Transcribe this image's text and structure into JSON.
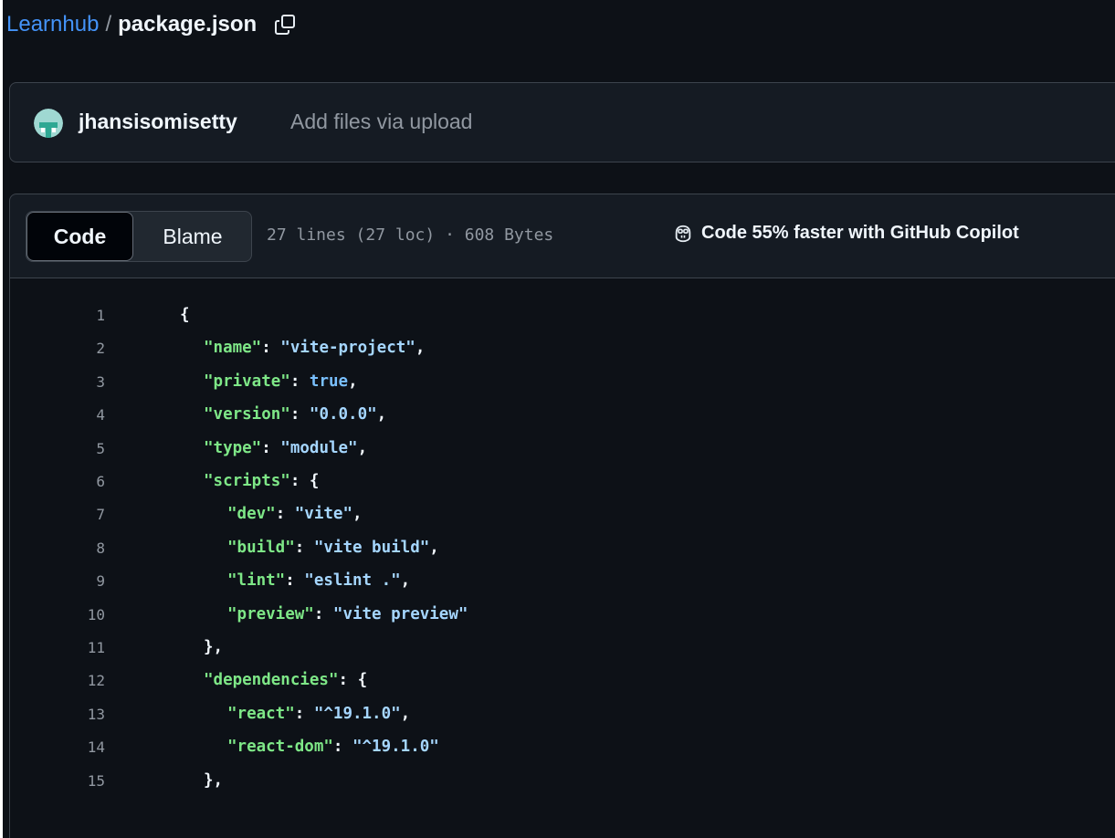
{
  "breadcrumb": {
    "repo": "Learnhub",
    "separator": "/",
    "file": "package.json"
  },
  "commit": {
    "author": "jhansisomisetty",
    "message": "Add files via upload"
  },
  "file_header": {
    "tabs": [
      {
        "label": "Code",
        "active": true
      },
      {
        "label": "Blame",
        "active": false
      }
    ],
    "info": "27 lines (27 loc) · 608 Bytes",
    "copilot_label": "Code 55% faster with GitHub Copilot"
  },
  "code_lines": [
    {
      "n": "1",
      "indent": 0,
      "tokens": [
        {
          "t": "p",
          "v": "{"
        }
      ]
    },
    {
      "n": "2",
      "indent": 1,
      "tokens": [
        {
          "t": "k",
          "v": "\"name\""
        },
        {
          "t": "p",
          "v": ": "
        },
        {
          "t": "s",
          "v": "\"vite-project\""
        },
        {
          "t": "p",
          "v": ","
        }
      ]
    },
    {
      "n": "3",
      "indent": 1,
      "tokens": [
        {
          "t": "k",
          "v": "\"private\""
        },
        {
          "t": "p",
          "v": ": "
        },
        {
          "t": "c",
          "v": "true"
        },
        {
          "t": "p",
          "v": ","
        }
      ]
    },
    {
      "n": "4",
      "indent": 1,
      "tokens": [
        {
          "t": "k",
          "v": "\"version\""
        },
        {
          "t": "p",
          "v": ": "
        },
        {
          "t": "s",
          "v": "\"0.0.0\""
        },
        {
          "t": "p",
          "v": ","
        }
      ]
    },
    {
      "n": "5",
      "indent": 1,
      "tokens": [
        {
          "t": "k",
          "v": "\"type\""
        },
        {
          "t": "p",
          "v": ": "
        },
        {
          "t": "s",
          "v": "\"module\""
        },
        {
          "t": "p",
          "v": ","
        }
      ]
    },
    {
      "n": "6",
      "indent": 1,
      "tokens": [
        {
          "t": "k",
          "v": "\"scripts\""
        },
        {
          "t": "p",
          "v": ": {"
        }
      ]
    },
    {
      "n": "7",
      "indent": 2,
      "tokens": [
        {
          "t": "k",
          "v": "\"dev\""
        },
        {
          "t": "p",
          "v": ": "
        },
        {
          "t": "s",
          "v": "\"vite\""
        },
        {
          "t": "p",
          "v": ","
        }
      ]
    },
    {
      "n": "8",
      "indent": 2,
      "tokens": [
        {
          "t": "k",
          "v": "\"build\""
        },
        {
          "t": "p",
          "v": ": "
        },
        {
          "t": "s",
          "v": "\"vite build\""
        },
        {
          "t": "p",
          "v": ","
        }
      ]
    },
    {
      "n": "9",
      "indent": 2,
      "tokens": [
        {
          "t": "k",
          "v": "\"lint\""
        },
        {
          "t": "p",
          "v": ": "
        },
        {
          "t": "s",
          "v": "\"eslint .\""
        },
        {
          "t": "p",
          "v": ","
        }
      ]
    },
    {
      "n": "10",
      "indent": 2,
      "tokens": [
        {
          "t": "k",
          "v": "\"preview\""
        },
        {
          "t": "p",
          "v": ": "
        },
        {
          "t": "s",
          "v": "\"vite preview\""
        }
      ]
    },
    {
      "n": "11",
      "indent": 1,
      "tokens": [
        {
          "t": "p",
          "v": "},"
        }
      ]
    },
    {
      "n": "12",
      "indent": 1,
      "tokens": [
        {
          "t": "k",
          "v": "\"dependencies\""
        },
        {
          "t": "p",
          "v": ": {"
        }
      ]
    },
    {
      "n": "13",
      "indent": 2,
      "tokens": [
        {
          "t": "k",
          "v": "\"react\""
        },
        {
          "t": "p",
          "v": ": "
        },
        {
          "t": "s",
          "v": "\"^19.1.0\""
        },
        {
          "t": "p",
          "v": ","
        }
      ]
    },
    {
      "n": "14",
      "indent": 2,
      "tokens": [
        {
          "t": "k",
          "v": "\"react-dom\""
        },
        {
          "t": "p",
          "v": ": "
        },
        {
          "t": "s",
          "v": "\"^19.1.0\""
        }
      ]
    },
    {
      "n": "15",
      "indent": 1,
      "tokens": [
        {
          "t": "p",
          "v": "},"
        }
      ]
    }
  ],
  "icons": {
    "copy": "copy-icon",
    "avatar": "user-avatar",
    "copilot": "copilot-icon"
  },
  "colors": {
    "background": "#0d1117",
    "link": "#4493f8",
    "key": "#7ee787",
    "string": "#a5d6ff",
    "constant": "#79c0ff"
  }
}
